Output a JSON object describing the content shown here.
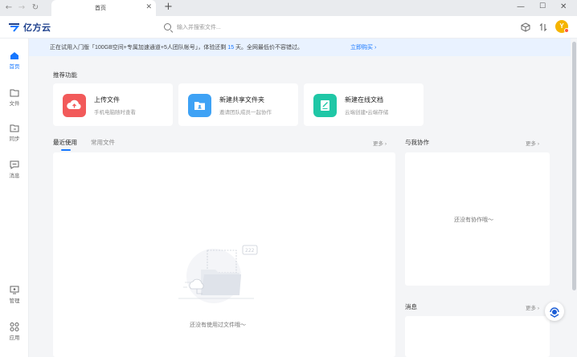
{
  "tab": {
    "title": "首页"
  },
  "search": {
    "placeholder": "输入并搜索文件..."
  },
  "logo": {
    "text": "亿方云"
  },
  "avatar": {
    "letter": "Y"
  },
  "rail": {
    "items": [
      {
        "label": "首页"
      },
      {
        "label": "文件"
      },
      {
        "label": "同步"
      },
      {
        "label": "消息"
      },
      {
        "label": "管理"
      },
      {
        "label": "应用"
      }
    ]
  },
  "banner": {
    "text_before": "正在试用入门版「100GB空间+专属加速通道+5人团队帐号」，体验还剩 ",
    "days": "15",
    "text_after": " 天。全网最低价不容错过。",
    "link": "立即购买"
  },
  "recommend": {
    "title": "推荐功能",
    "cards": [
      {
        "title": "上传文件",
        "subtitle": "手机电脑随时查看"
      },
      {
        "title": "新建共享文件夹",
        "subtitle": "邀请团队成员一起协作"
      },
      {
        "title": "新建在线文档",
        "subtitle": "云端创建•云端存储"
      }
    ]
  },
  "recent": {
    "tabs": [
      {
        "label": "最近使用"
      },
      {
        "label": "常用文件"
      }
    ],
    "more": "更多",
    "empty": "还没有使用过文件哦～"
  },
  "collab": {
    "title": "与我协作",
    "more": "更多",
    "empty": "还没有协作哦～"
  },
  "messages": {
    "title": "消息",
    "more": "更多"
  },
  "colors": {
    "accent": "#1677ff",
    "upload": "#f25a5a",
    "folder": "#3ea2f5",
    "doc": "#1fc7a6"
  }
}
